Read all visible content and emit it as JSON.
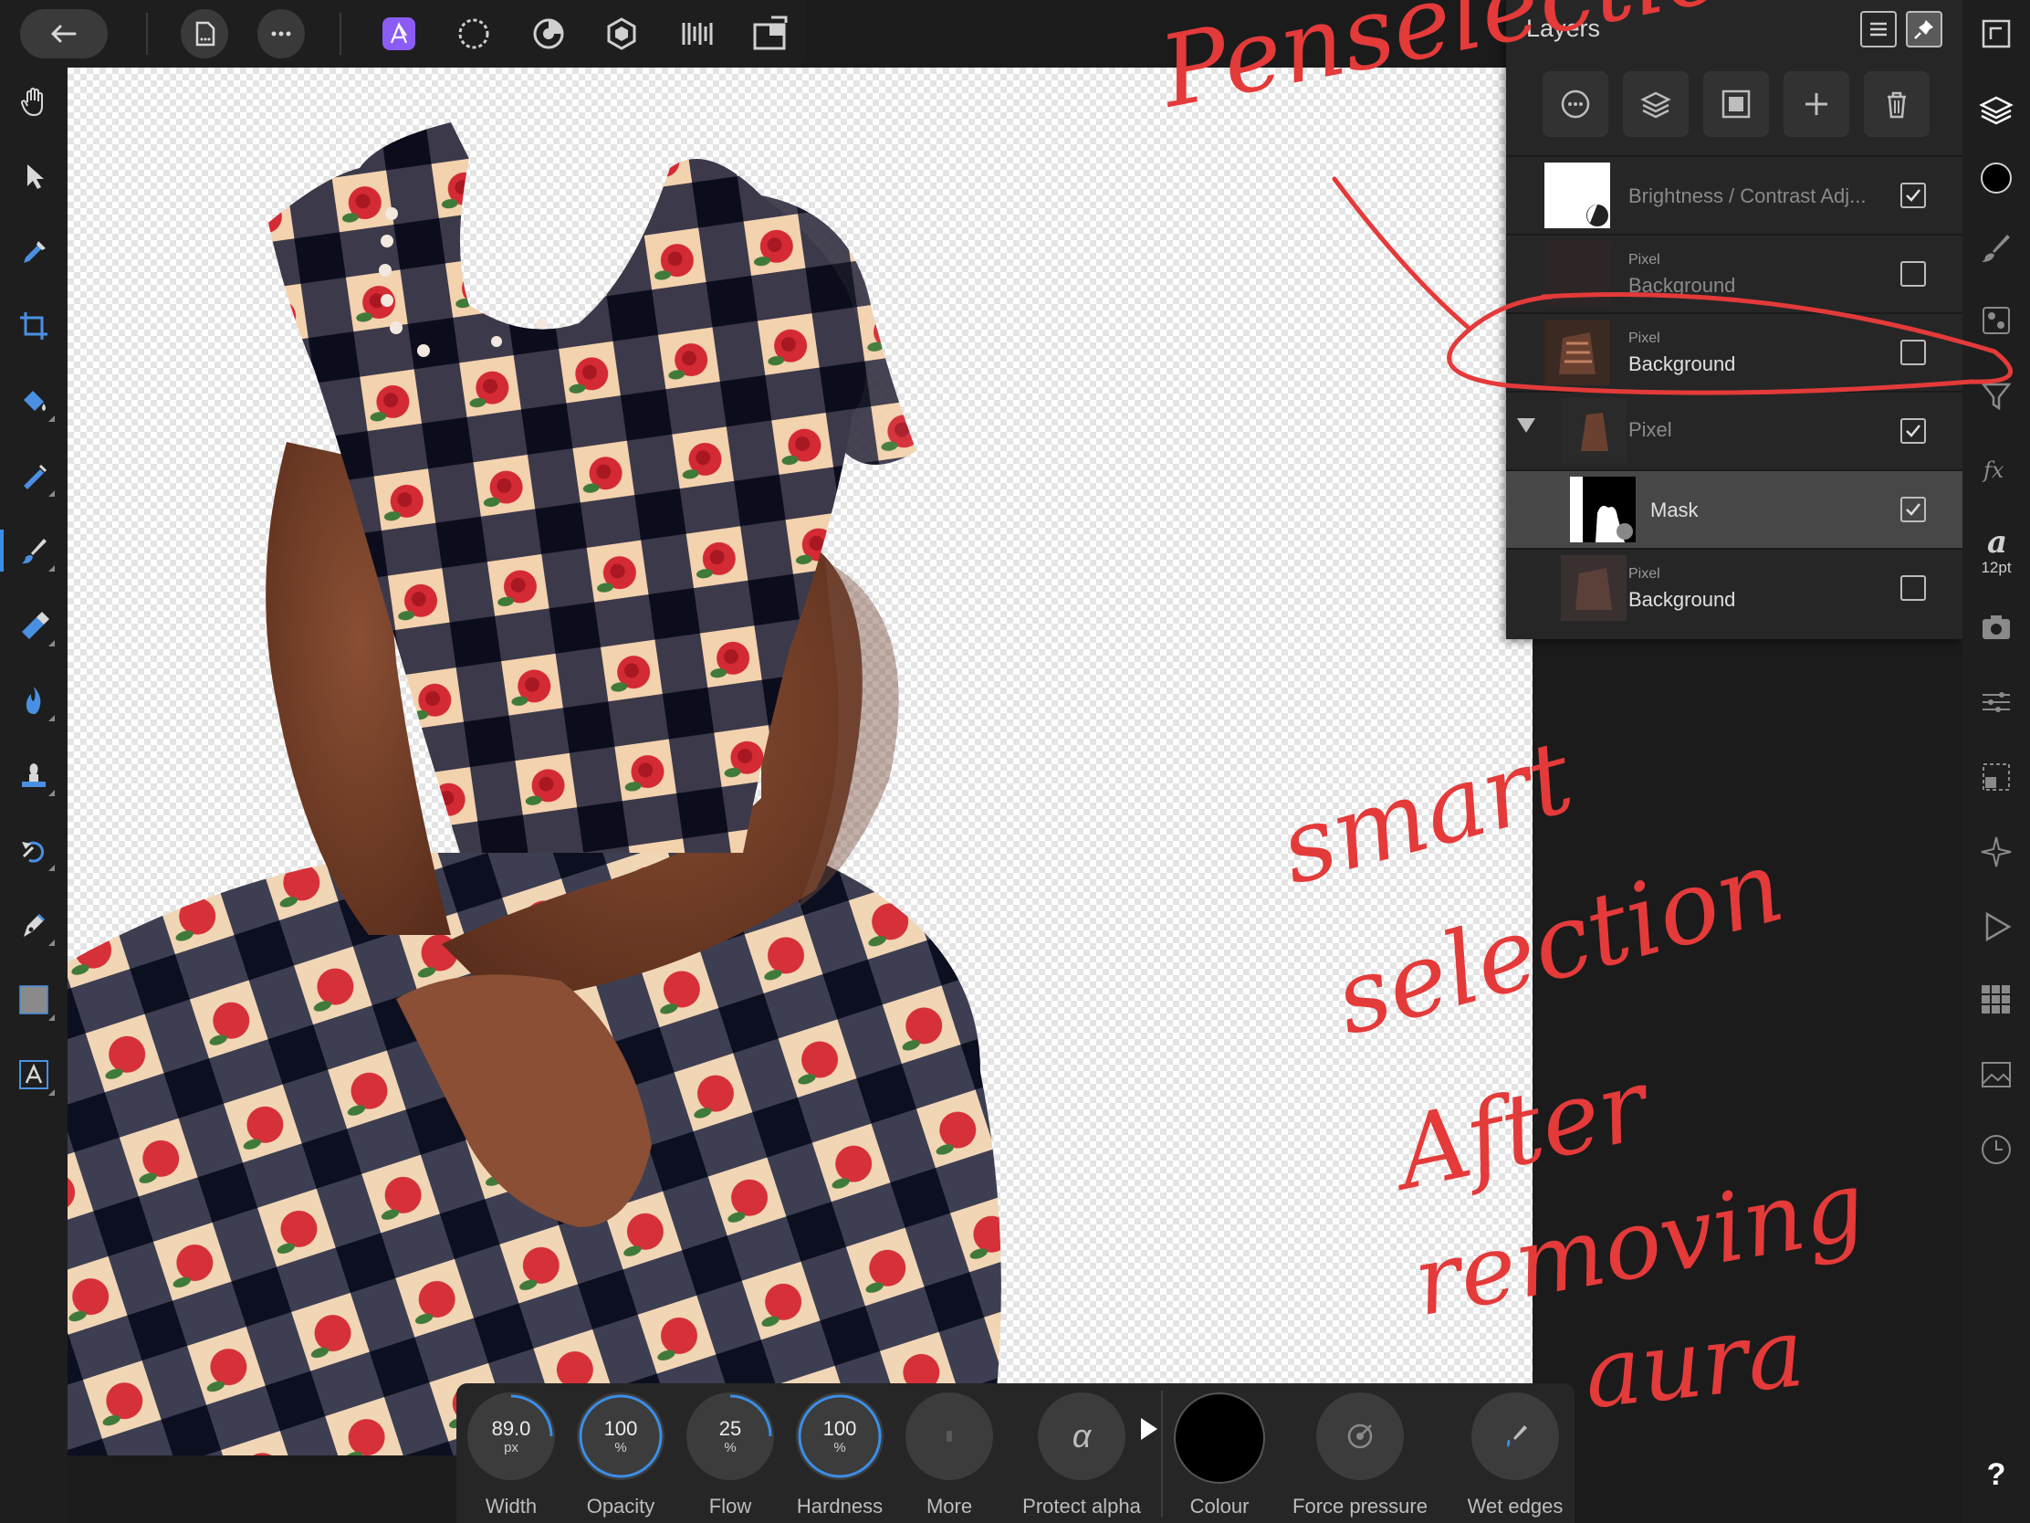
{
  "layers_panel": {
    "title": "Layers",
    "layers": [
      {
        "type": "",
        "name": "Brightness / Contrast Adj...",
        "checked": true
      },
      {
        "type": "Pixel",
        "name": "Background",
        "checked": false
      },
      {
        "type": "Pixel",
        "name": "Background",
        "checked": false
      },
      {
        "type": "",
        "name": "Pixel",
        "checked": true
      },
      {
        "type": "",
        "name": "Mask",
        "checked": true
      },
      {
        "type": "Pixel",
        "name": "Background",
        "checked": false
      }
    ]
  },
  "right_strip": {
    "font_size": "12pt",
    "help": "?"
  },
  "context_toolbar": {
    "width": {
      "value": "89.0",
      "unit": "px",
      "label": "Width"
    },
    "opacity": {
      "value": "100",
      "unit": "%",
      "label": "Opacity"
    },
    "flow": {
      "value": "25",
      "unit": "%",
      "label": "Flow"
    },
    "hardness": {
      "value": "100",
      "unit": "%",
      "label": "Hardness"
    },
    "more": {
      "label": "More"
    },
    "protect_alpha": {
      "label": "Protect alpha",
      "glyph": "α"
    },
    "colour": {
      "label": "Colour",
      "value": "#000000"
    },
    "force_pressure": {
      "label": "Force pressure"
    },
    "wet_edges": {
      "label": "Wet edges"
    }
  },
  "annotations": {
    "top": "Penselection",
    "bottom_line1": "smart",
    "bottom_line2": "selection",
    "bottom_line3": "After",
    "bottom_line4": "removing",
    "bottom_line5": "aura"
  },
  "colors": {
    "accent": "#3a8ee6",
    "annotation": "#e43a3a",
    "persona_active": "#8b5cf6"
  }
}
